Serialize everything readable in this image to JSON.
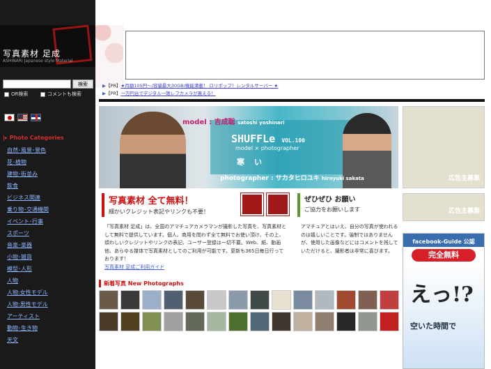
{
  "logo": {
    "text": "写真素材 足成",
    "subtitle": "ASHINARI Japanese style Material"
  },
  "search": {
    "button_label": "検索",
    "placeholder": "",
    "option_or": "OR検索",
    "option_comment": "コメントも検索"
  },
  "languages": [
    "jp-flag-icon",
    "us-flag-icon",
    "uk-flag-icon"
  ],
  "categories": {
    "heading": "Photo Categories",
    "items": [
      "自然･風景･景色",
      "花･植物",
      "建物･街並み",
      "飲食",
      "ビジネス関連",
      "乗り物･交通機関",
      "イベント･行事",
      "スポーツ",
      "音楽･楽器",
      "小物･雑貨",
      "模型･人形",
      "人物",
      "人物:女性モデル",
      "人物:男性モデル",
      "アーティスト",
      "動物･生き物",
      "天文"
    ]
  },
  "pr_lines": [
    {
      "prefix": "【PR】",
      "text": "★月額105円～/容量最大30GB/機能満載！ ロリポップ！レンタルサーバー ★"
    },
    {
      "prefix": "【PR】",
      "text": "一万円台でデジタル一眼レフカメラが買える！"
    }
  ],
  "banner": {
    "model": "model : 吉成聡",
    "model_roman": "satoshi yoshinari",
    "title": "SHUFFLe",
    "vol": "VOL.100",
    "tagline": "model × photographer",
    "word": "寒い",
    "photographer": "photographer : サカタヒロユキ",
    "photographer_roman": "hiroyuki sakata"
  },
  "side_ads": {
    "ad1": "広告主募集",
    "ad2": "広告主募集"
  },
  "fb_ad": {
    "title": "facebook-Guide 公認",
    "free": "完全無料",
    "big": "えっ!?",
    "sub": "空いた時間で"
  },
  "free_block": {
    "title": "写真素材 全て無料！",
    "subtitle": "細かいクレジット表記やリンクも不要！"
  },
  "fav_block": {
    "title": "ぜひぜひ お願い",
    "subtitle": "ご協力をお願いします"
  },
  "intro": {
    "text": "「写真素材 足成」は、全国のアマチュアカメラマンが撮影した写真を、写真素材として無料で提供しています。個人、商用を問わず全て無料でお使い頂け、その上、煩わしいクレジットやリンクの表記、ユーザー登録は一切不要。Web、紙、動画他、あらゆる媒体で写真素材としてのご利用が可能です。更新も365日毎日行っております！",
    "link": "写真素材 足成ご利用ガイド"
  },
  "notice": "アマチュアとはいえ、自分の写真が使われるのは嬉しいことです。強制ではありませんが、使用した画像などにはコメントを残していただけると、撮影者は非常に喜びます。",
  "new_photos": {
    "heading": "新着写真 New Photographs",
    "thumb_colors": [
      "#6a5a4a",
      "#3a3a3a",
      "#9ab0c8",
      "#506070",
      "#5a4a3a",
      "#c8c8c8",
      "#8a9aa8",
      "#404848",
      "#e8e0d0",
      "#7a8aa0",
      "#b0b8c0",
      "#a04a30",
      "#806050",
      "#c04040",
      "#4a3a2a",
      "#504020",
      "#809050",
      "#a0a0a0",
      "#606858",
      "#a8b8a0",
      "#507030",
      "#506878",
      "#403830",
      "#c0b0a0",
      "#908070",
      "#282828",
      "#909890",
      "#c02020"
    ]
  }
}
